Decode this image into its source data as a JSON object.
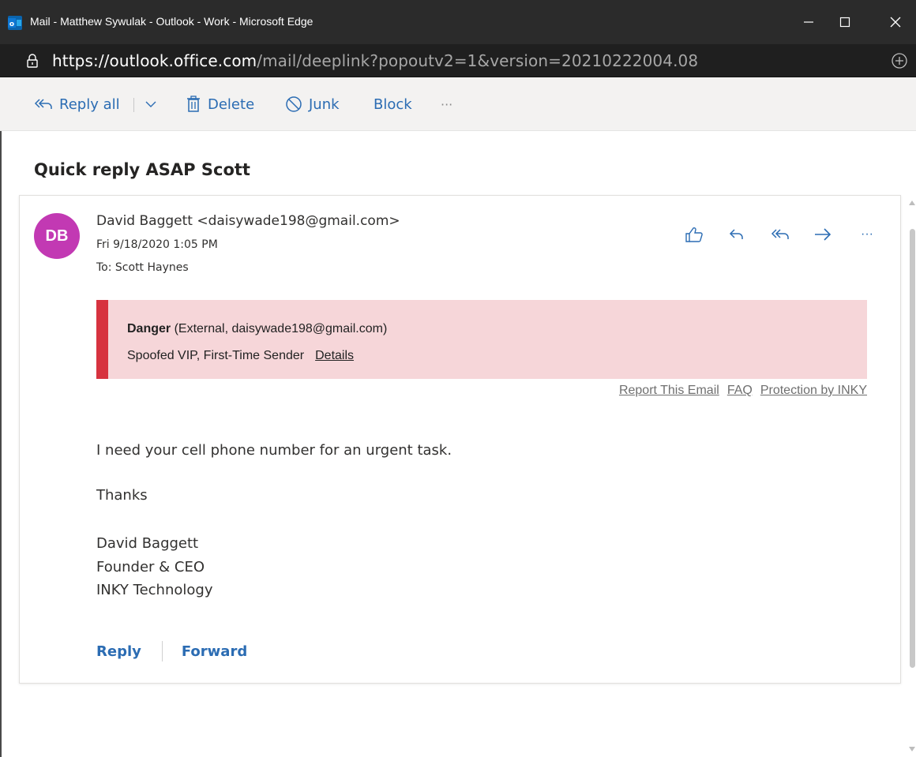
{
  "window": {
    "title": "Mail - Matthew Sywulak - Outlook - Work - Microsoft Edge",
    "url_host": "https://outlook.office.com",
    "url_path": "/mail/deeplink?popoutv2=1&version=20210222004.08"
  },
  "toolbar": {
    "reply_all": "Reply all",
    "delete": "Delete",
    "junk": "Junk",
    "block": "Block",
    "more": "···"
  },
  "message": {
    "subject": "Quick reply ASAP Scott",
    "avatar_initials": "DB",
    "avatar_color": "#c239b3",
    "sender": "David Baggett <daisywade198@gmail.com>",
    "date": "Fri 9/18/2020 1:05 PM",
    "to_label": "To:",
    "to_value": "Scott Haynes",
    "more": "···"
  },
  "banner": {
    "level": "Danger",
    "detail": "(External, daisywade198@gmail.com)",
    "reasons": "Spoofed VIP, First-Time Sender",
    "details_link": "Details",
    "color": "#d7333f"
  },
  "links": {
    "report": "Report This Email",
    "faq": "FAQ",
    "protection": "Protection by INKY"
  },
  "body": {
    "line1": "I need your cell phone number for an urgent task.",
    "line2": "Thanks",
    "sig1": "David Baggett",
    "sig2": "Founder & CEO",
    "sig3": "INKY Technology"
  },
  "actions": {
    "reply": "Reply",
    "forward": "Forward"
  }
}
